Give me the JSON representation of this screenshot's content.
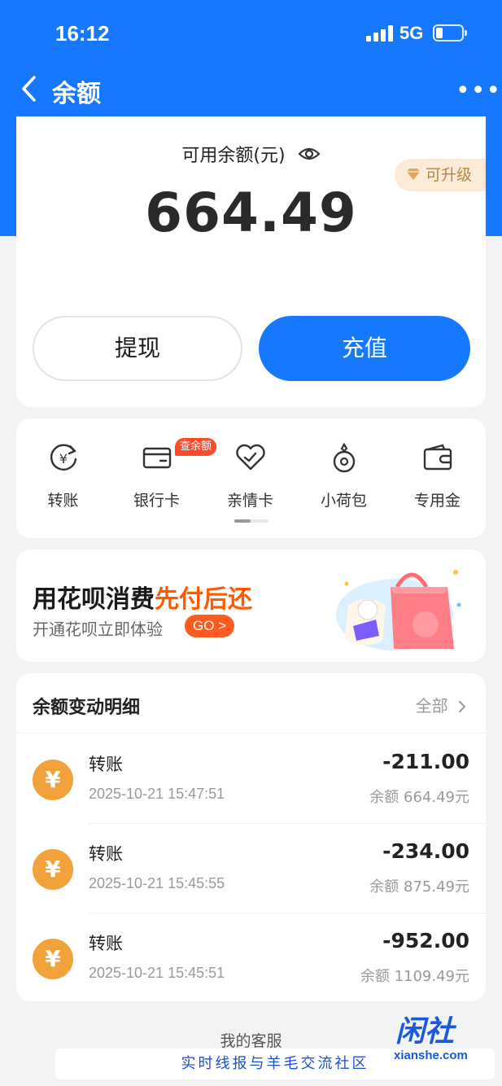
{
  "status_bar": {
    "time": "16:12",
    "network": "5G"
  },
  "nav": {
    "title": "余额",
    "more": "•••"
  },
  "balance": {
    "label": "可用余额(元)",
    "amount": "664.49",
    "upgrade_label": "可升级",
    "withdraw_label": "提现",
    "recharge_label": "充值"
  },
  "services": {
    "items": [
      {
        "label": "转账",
        "icon": "transfer-icon"
      },
      {
        "label": "银行卡",
        "icon": "bank-card-icon"
      },
      {
        "label": "亲情卡",
        "icon": "family-card-icon"
      },
      {
        "label": "小荷包",
        "icon": "small-pouch-icon"
      },
      {
        "label": "专用金",
        "icon": "wallet-icon"
      }
    ],
    "badge": "查余额"
  },
  "promo": {
    "title_main": "用花呗消费",
    "title_highlight": "先付后还",
    "subtitle": "开通花呗立即体验",
    "go_label": "GO >"
  },
  "details": {
    "title": "余额变动明细",
    "all_label": "全部",
    "transactions": [
      {
        "name": "转账",
        "time": "2025-10-21 15:47:51",
        "amount": "-211.00",
        "balance": "余额 664.49元"
      },
      {
        "name": "转账",
        "time": "2025-10-21 15:45:55",
        "amount": "-234.00",
        "balance": "余额 875.49元"
      },
      {
        "name": "转账",
        "time": "2025-10-21 15:45:51",
        "amount": "-952.00",
        "balance": "余额 1109.49元"
      }
    ]
  },
  "footer": {
    "service_link": "我的客服",
    "watermark_text": "实时线报与羊毛交流社区",
    "watermark_logo": "闲社",
    "watermark_site": "xianshe.com"
  },
  "colors": {
    "primary": "#1677ff",
    "promo_highlight": "#ff5a00",
    "coin": "#f2a23a",
    "badge": "#ff4a2a"
  }
}
